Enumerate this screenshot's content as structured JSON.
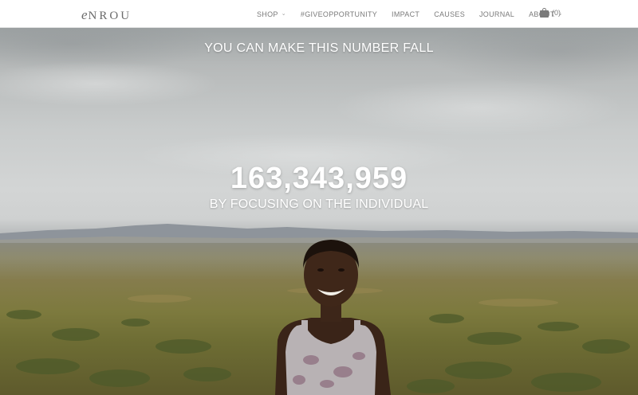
{
  "nav": {
    "logo": {
      "mark": "e",
      "text": "NROU"
    },
    "items": [
      {
        "label": "SHOP",
        "has_dropdown": true,
        "icon": "chevron-down-icon"
      },
      {
        "label": "#GIVEOPPORTUNITY",
        "has_dropdown": false
      },
      {
        "label": "IMPACT",
        "has_dropdown": false
      },
      {
        "label": "CAUSES",
        "has_dropdown": false
      },
      {
        "label": "JOURNAL",
        "has_dropdown": false
      },
      {
        "label": "ABOUT",
        "has_dropdown": true,
        "icon": "chevron-down-icon"
      }
    ],
    "cart": {
      "icon": "shopping-bag-icon",
      "count": "(0)"
    }
  },
  "hero": {
    "heading": "YOU CAN MAKE THIS NUMBER FALL",
    "number": "163,343,959",
    "subheading": "BY FOCUSING ON THE INDIVIDUAL",
    "image": "smiling-woman-in-savanna-photo"
  },
  "colors": {
    "nav_background": "#ffffff",
    "nav_text": "#7a7a7a",
    "hero_text": "#ffffff",
    "sky": "#c9cccc",
    "grassland": "#7d7a3e"
  }
}
